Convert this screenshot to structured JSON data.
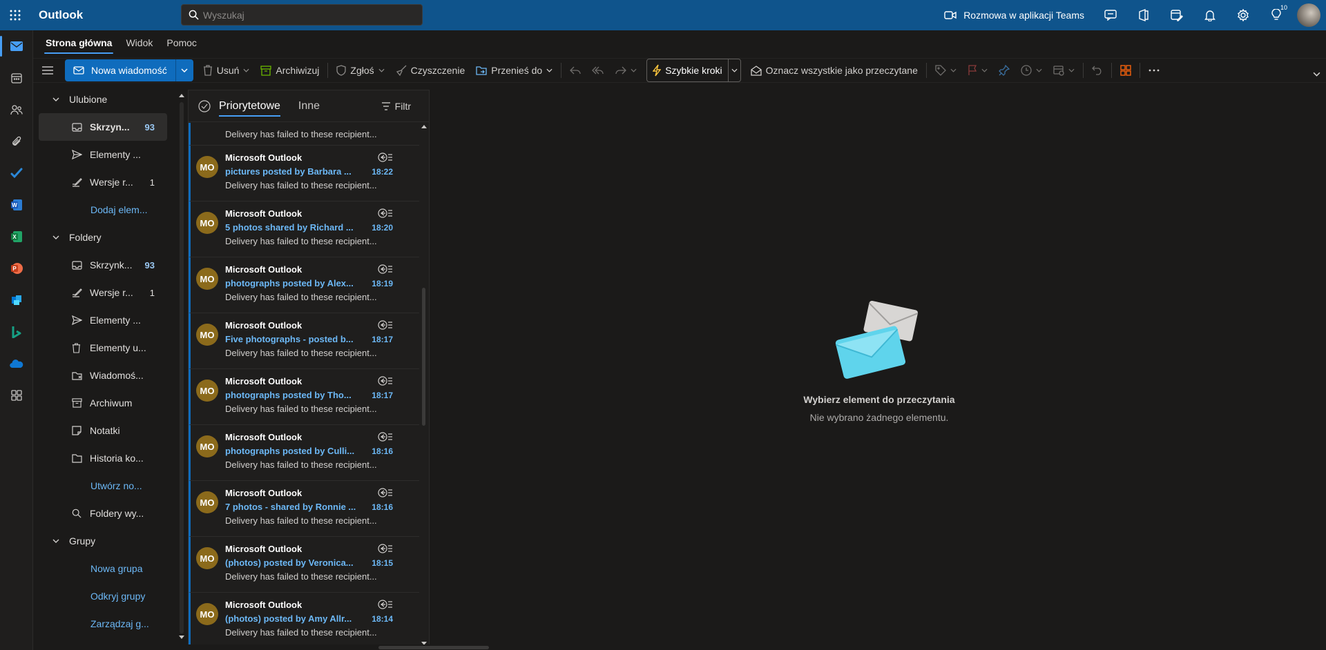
{
  "app": {
    "title": "Outlook"
  },
  "search": {
    "placeholder": "Wyszukaj"
  },
  "topbar": {
    "teams_label": "Rozmowa w aplikacji Teams",
    "tips_badge": "10"
  },
  "tabs": [
    {
      "label": "Strona główna",
      "active": true
    },
    {
      "label": "Widok",
      "active": false
    },
    {
      "label": "Pomoc",
      "active": false
    }
  ],
  "ribbon": {
    "new_mail": "Nowa wiadomość",
    "delete": "Usuń",
    "archive": "Archiwizuj",
    "report": "Zgłoś",
    "sweep": "Czyszczenie",
    "move": "Przenieś do",
    "quick_steps": "Szybkie kroki",
    "mark_all_read": "Oznacz wszystkie jako przeczytane"
  },
  "nav": {
    "favorites_header": "Ulubione",
    "favorites": [
      {
        "label": "Skrzyn...",
        "count": "93",
        "icon": "inbox-icon",
        "selected": true
      },
      {
        "label": "Elementy ...",
        "count": "",
        "icon": "send-icon",
        "selected": false
      },
      {
        "label": "Wersje r...",
        "count": "1",
        "icon": "draft-icon",
        "selected": false
      }
    ],
    "add_favorite": "Dodaj elem...",
    "folders_header": "Foldery",
    "folders": [
      {
        "label": "Skrzynk...",
        "count": "93",
        "icon": "inbox-icon"
      },
      {
        "label": "Wersje r...",
        "count": "1",
        "icon": "draft-icon"
      },
      {
        "label": "Elementy ...",
        "count": "",
        "icon": "send-icon"
      },
      {
        "label": "Elementy u...",
        "count": "",
        "icon": "trash-icon"
      },
      {
        "label": "Wiadomoś...",
        "count": "",
        "icon": "junk-icon"
      },
      {
        "label": "Archiwum",
        "count": "",
        "icon": "archive-icon"
      },
      {
        "label": "Notatki",
        "count": "",
        "icon": "note-icon"
      },
      {
        "label": "Historia ko...",
        "count": "",
        "icon": "folder-icon"
      }
    ],
    "create_folder": "Utwórz no...",
    "search_folders": "Foldery wy...",
    "groups_header": "Grupy",
    "new_group": "Nowa grupa",
    "discover_groups": "Odkryj grupy",
    "manage_groups": "Zarządzaj g..."
  },
  "list": {
    "tab_focused": "Priorytetowe",
    "tab_other": "Inne",
    "filter": "Filtr",
    "partial_preview": "Delivery has failed to these recipient...",
    "messages": [
      {
        "initials": "MO",
        "sender": "Microsoft Outlook",
        "subject": "pictures posted by Barbara ...",
        "time": "18:22",
        "preview": "Delivery has failed to these recipient..."
      },
      {
        "initials": "MO",
        "sender": "Microsoft Outlook",
        "subject": "5 photos shared by Richard ...",
        "time": "18:20",
        "preview": "Delivery has failed to these recipient..."
      },
      {
        "initials": "MO",
        "sender": "Microsoft Outlook",
        "subject": "photographs posted by Alex...",
        "time": "18:19",
        "preview": "Delivery has failed to these recipient..."
      },
      {
        "initials": "MO",
        "sender": "Microsoft Outlook",
        "subject": "Five photographs - posted b...",
        "time": "18:17",
        "preview": "Delivery has failed to these recipient..."
      },
      {
        "initials": "MO",
        "sender": "Microsoft Outlook",
        "subject": "photographs posted by Tho...",
        "time": "18:17",
        "preview": "Delivery has failed to these recipient..."
      },
      {
        "initials": "MO",
        "sender": "Microsoft Outlook",
        "subject": "photographs posted by Culli...",
        "time": "18:16",
        "preview": "Delivery has failed to these recipient..."
      },
      {
        "initials": "MO",
        "sender": "Microsoft Outlook",
        "subject": "7 photos - shared by Ronnie ...",
        "time": "18:16",
        "preview": "Delivery has failed to these recipient..."
      },
      {
        "initials": "MO",
        "sender": "Microsoft Outlook",
        "subject": "(photos) posted by Veronica...",
        "time": "18:15",
        "preview": "Delivery has failed to these recipient..."
      },
      {
        "initials": "MO",
        "sender": "Microsoft Outlook",
        "subject": "(photos) posted by Amy Allr...",
        "time": "18:14",
        "preview": "Delivery has failed to these recipient..."
      }
    ]
  },
  "reading": {
    "title": "Wybierz element do przeczytania",
    "subtitle": "Nie wybrano żadnego elementu."
  },
  "colors": {
    "accent": "#0f6cbd",
    "topbar": "#0f548c",
    "link": "#6cb8f6",
    "avatar": "#8b6a1b"
  }
}
